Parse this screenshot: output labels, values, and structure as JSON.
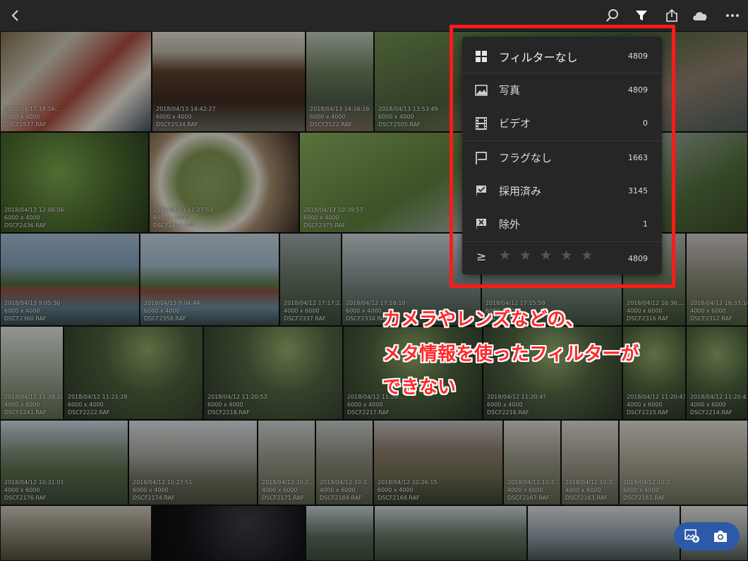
{
  "filter_menu": {
    "items": [
      {
        "icon": "grid-icon",
        "label": "フィルターなし",
        "count": "4809"
      },
      {
        "icon": "photo-icon",
        "label": "写真",
        "count": "4809"
      },
      {
        "icon": "film-icon",
        "label": "ビデオ",
        "count": "0"
      },
      {
        "icon": "flag-outline-icon",
        "label": "フラグなし",
        "count": "1663"
      },
      {
        "icon": "flag-pick-icon",
        "label": "採用済み",
        "count": "3145"
      },
      {
        "icon": "flag-reject-icon",
        "label": "除外",
        "count": "1"
      }
    ],
    "rating": {
      "operator": "≥",
      "stars": 5,
      "filled": 0,
      "count": "4809"
    }
  },
  "annotation": {
    "line1": "カメラやレンズなどの、",
    "line2": "メタ情報を使ったフィルターが",
    "line3": "できない",
    "color": "#ff2a2a"
  },
  "toolbar": {
    "icons": [
      "back-icon",
      "search-icon",
      "filter-icon",
      "share-icon",
      "cloud-icon",
      "more-icon"
    ]
  },
  "add_buttons": {
    "icons": [
      "add-photo-icon",
      "camera-icon"
    ],
    "color": "#2c5aa8"
  },
  "photos": [
    {
      "date": "2018/04/13 18:16:..",
      "dims": "6000 x 4000",
      "file": "DSCF2577.RAF"
    },
    {
      "date": "2018/04/13 14:42:27",
      "dims": "6000 x 4000",
      "file": "DSCF2534.RAF"
    },
    {
      "date": "2018/04/13 14:16:16",
      "dims": "6000 x 4000",
      "file": "DSCF2522.RAF"
    },
    {
      "date": "2018/04/13 13:53:49",
      "dims": "6000 x 4000",
      "file": "DSCF2505.RAF"
    },
    {
      "date": "2018/04/13 12:06:06",
      "dims": "6000 x 4000",
      "file": "DSCF2436.RAF"
    },
    {
      "date": "2018/04/13 11:27:53",
      "dims": "6000 x 4000",
      "file": "DSCF2414.RAF"
    },
    {
      "date": "2018/04/13 10:39:57",
      "dims": "6000 x 4000",
      "file": "DSCF2375.RAF"
    },
    {
      "date": "2018/04/13 9:05:30",
      "dims": "6000 x 4000",
      "file": "DSCF2360.RAF"
    },
    {
      "date": "2018/04/13 9:04:44",
      "dims": "6000 x 4000",
      "file": "DSCF2358.RAF"
    },
    {
      "date": "2018/04/12 17:17:23",
      "dims": "4000 x 6000",
      "file": "DSCF2337.RAF"
    },
    {
      "date": "2018/04/12 17:16:10",
      "dims": "6000 x 4000",
      "file": "DSCF2334.RAF"
    },
    {
      "date": "2018/04/12 17:15:59",
      "dims": "6000 x 4000",
      "file": "DSCF2333.RAF"
    },
    {
      "date": "2018/04/12 16:36:...",
      "dims": "4000 x 6000",
      "file": "DSCF2316.RAF"
    },
    {
      "date": "2018/04/12 16:33:16",
      "dims": "4000 x 6000",
      "file": "DSCF2312.RAF"
    },
    {
      "date": "2018/04/12 11:39:29",
      "dims": "4000 x 6000",
      "file": "DSCF2241.RAF"
    },
    {
      "date": "2018/04/12 11:21:28",
      "dims": "6000 x 4000",
      "file": "DSCF2222.RAF"
    },
    {
      "date": "2018/04/12 11:20:53",
      "dims": "6000 x 4000",
      "file": "DSCF2218.RAF"
    },
    {
      "date": "2018/04/12 11:20:..",
      "dims": "6000 x 4000",
      "file": "DSCF2217.RAF"
    },
    {
      "date": "2018/04/12 11:20:4?",
      "dims": "6000 x 4000",
      "file": "DSCF2216.RAF"
    },
    {
      "date": "2018/04/12 11:20:43",
      "dims": "4000 x 6000",
      "file": "DSCF2215.RAF"
    },
    {
      "date": "2018/04/12 11:20:41",
      "dims": "4000 x 6000",
      "file": "DSCF2214.RAF"
    },
    {
      "date": "2018/04/12 10:31:01",
      "dims": "4000 x 6000",
      "file": "DSCF2176.RAF"
    },
    {
      "date": "2018/04/12 10:27:51",
      "dims": "6000 x 4000",
      "file": "DSCF2174.RAF"
    },
    {
      "date": "2018/04/12 10:2..",
      "dims": "4000 x 6000",
      "file": "DSCF2171.RAF"
    },
    {
      "date": "2018/04/12 10:2..",
      "dims": "4000 x 6000",
      "file": "DSCF2169.RAF"
    },
    {
      "date": "2018/04/12 10:26:15",
      "dims": "6000 x 4000",
      "file": "DSCF2168.RAF"
    },
    {
      "date": "2018/04/12 10:2..",
      "dims": "4000 x 6000",
      "file": "DSCF2167.RAF"
    },
    {
      "date": "2018/04/12 10:2..",
      "dims": "4000 x 6000",
      "file": "DSCF2163.RAF"
    },
    {
      "date": "2018/04/12 10:2..",
      "dims": "6000 x 4000",
      "file": "DSCF2161.RAF"
    }
  ]
}
